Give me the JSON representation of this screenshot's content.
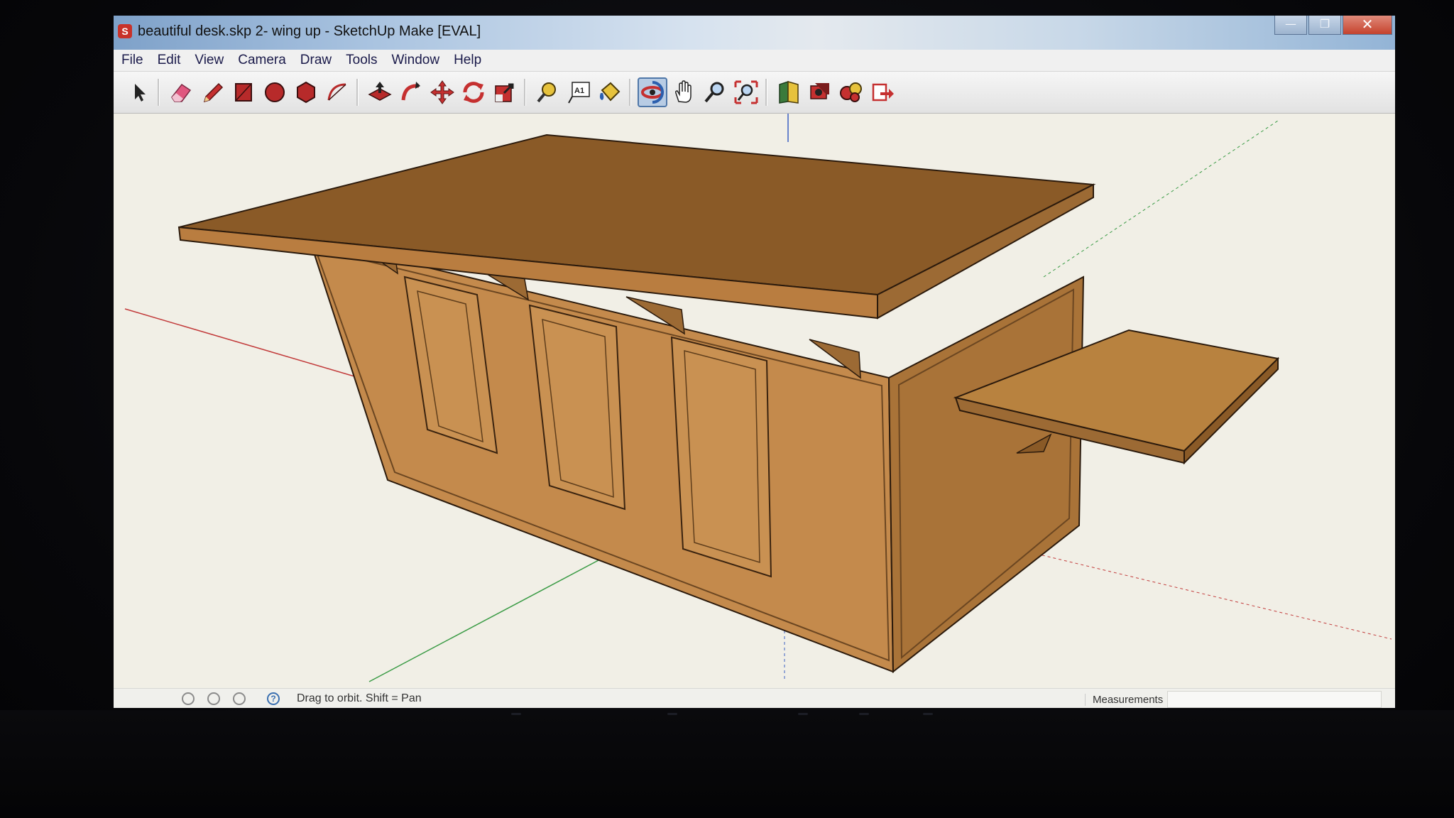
{
  "window": {
    "title": "beautiful desk.skp 2- wing up - SketchUp Make [EVAL]",
    "app_icon_glyph": "S",
    "controls": {
      "minimize": "—",
      "maximize": "❐",
      "close": "✕"
    }
  },
  "menu": {
    "items": [
      "File",
      "Edit",
      "View",
      "Camera",
      "Draw",
      "Tools",
      "Window",
      "Help"
    ]
  },
  "toolbar": {
    "tools": [
      {
        "name": "select-tool",
        "icon": "arrow-icon"
      },
      {
        "name": "eraser-tool",
        "icon": "eraser-icon"
      },
      {
        "name": "pencil-tool",
        "icon": "pencil-icon"
      },
      {
        "name": "rectangle-tool",
        "icon": "rectangle-icon"
      },
      {
        "name": "circle-tool",
        "icon": "circle-icon"
      },
      {
        "name": "polygon-tool",
        "icon": "polygon-icon"
      },
      {
        "name": "arc-tool",
        "icon": "arc-icon"
      },
      {
        "name": "push-pull-tool",
        "icon": "push-pull-icon"
      },
      {
        "name": "follow-me-tool",
        "icon": "follow-me-icon"
      },
      {
        "name": "move-tool",
        "icon": "move-icon"
      },
      {
        "name": "rotate-tool",
        "icon": "rotate-icon"
      },
      {
        "name": "scale-tool",
        "icon": "scale-icon"
      },
      {
        "name": "tape-measure-tool",
        "icon": "tape-measure-icon"
      },
      {
        "name": "text-tool",
        "icon": "text-icon"
      },
      {
        "name": "paint-bucket-tool",
        "icon": "paint-bucket-icon"
      },
      {
        "name": "orbit-tool",
        "icon": "orbit-icon",
        "active": true
      },
      {
        "name": "pan-tool",
        "icon": "hand-icon"
      },
      {
        "name": "zoom-tool",
        "icon": "magnifier-icon"
      },
      {
        "name": "zoom-extents-tool",
        "icon": "zoom-extents-icon"
      },
      {
        "name": "warehouse-tool",
        "icon": "warehouse-icon"
      },
      {
        "name": "share-model-tool",
        "icon": "share-model-icon"
      },
      {
        "name": "extension-tool",
        "icon": "extension-icon"
      },
      {
        "name": "layout-send-tool",
        "icon": "send-to-layout-icon"
      }
    ],
    "text_tool_glyph": "A1"
  },
  "status": {
    "hint": "Drag to orbit.  Shift = Pan",
    "help_glyph": "?",
    "measurements_label": "Measurements",
    "measurements_value": ""
  },
  "colors": {
    "wood_top": "#8a5a27",
    "wood_front": "#c48a4c",
    "wood_side": "#a97338",
    "viewport_bg": "#f1efe6",
    "axis_red": "#c23b3b",
    "axis_green": "#3a9b45",
    "axis_blue": "#3b5fc2",
    "active_tool": "#b8cce4"
  }
}
